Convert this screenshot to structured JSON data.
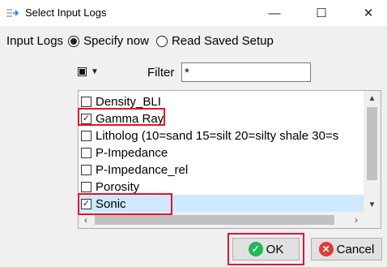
{
  "window": {
    "title": "Select Input Logs",
    "minimize_glyph": "—",
    "maximize_glyph": "☐",
    "close_glyph": "✕"
  },
  "input_logs": {
    "label": "Input Logs",
    "options": [
      {
        "label": "Specify now",
        "selected": true
      },
      {
        "label": "Read Saved Setup",
        "selected": false
      }
    ]
  },
  "filter": {
    "label": "Filter",
    "value": "*"
  },
  "logs": [
    {
      "label": "Density_BLI",
      "checked": false,
      "selected": false
    },
    {
      "label": "Gamma Ray",
      "checked": true,
      "selected": false
    },
    {
      "label": "Litholog (10=sand 15=silt 20=silty shale 30=s",
      "checked": false,
      "selected": false
    },
    {
      "label": "P-Impedance",
      "checked": false,
      "selected": false
    },
    {
      "label": "P-Impedance_rel",
      "checked": false,
      "selected": false
    },
    {
      "label": "Porosity",
      "checked": false,
      "selected": false
    },
    {
      "label": "Sonic",
      "checked": true,
      "selected": true
    }
  ],
  "buttons": {
    "ok": "OK",
    "cancel": "Cancel"
  },
  "colors": {
    "highlight_border": "#e8112d",
    "selection": "#cde8ff",
    "ok_icon": "#1db954",
    "cancel_icon": "#e53935"
  }
}
